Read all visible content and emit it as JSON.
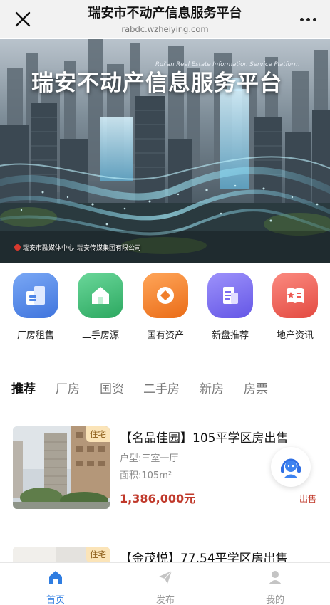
{
  "header": {
    "title": "瑞安市不动产信息服务平台",
    "subtitle": "rabdc.wzheiying.com",
    "close_icon": "close-icon",
    "more_icon": "more-dots-icon"
  },
  "banner": {
    "heading": "瑞安不动产信息服务平台",
    "english": "Rui'an Real Estate Information Service Platform",
    "credit_left": "瑞安市融媒体中心",
    "credit_right": "瑞安传媒集团有限公司"
  },
  "categories": [
    {
      "label": "厂房租售",
      "icon": "factory-building-icon",
      "color": "#4f86e8"
    },
    {
      "label": "二手房源",
      "icon": "house-icon",
      "color": "#3cbf72"
    },
    {
      "label": "国有资产",
      "icon": "coin-icon",
      "color": "#f07f2c"
    },
    {
      "label": "新盘推荐",
      "icon": "document-building-icon",
      "color": "#7b6cf0"
    },
    {
      "label": "地产资讯",
      "icon": "news-book-icon",
      "color": "#ee5a52"
    }
  ],
  "tabs": [
    "推荐",
    "厂房",
    "国资",
    "二手房",
    "新房",
    "房票"
  ],
  "active_tab": "推荐",
  "listings": [
    {
      "badge": "住宅",
      "title": "【名品佳园】105平学区房出售",
      "layout": "户型:三室一厅",
      "area": "面积:105m²",
      "price": "1,386,000元"
    },
    {
      "badge": "住宅",
      "title": "【金茂悦】77.54平学区房出售"
    }
  ],
  "float_service": {
    "icon": "customer-service-icon",
    "label": "出售"
  },
  "bottom_nav": [
    {
      "label": "首页",
      "icon": "home-icon",
      "active": true
    },
    {
      "label": "发布",
      "icon": "send-icon",
      "active": false
    },
    {
      "label": "我的",
      "icon": "user-icon",
      "active": false
    }
  ],
  "colors": {
    "accent": "#2f7de1",
    "price": "#c0392b",
    "badge_bg": "#fbe4b8"
  }
}
